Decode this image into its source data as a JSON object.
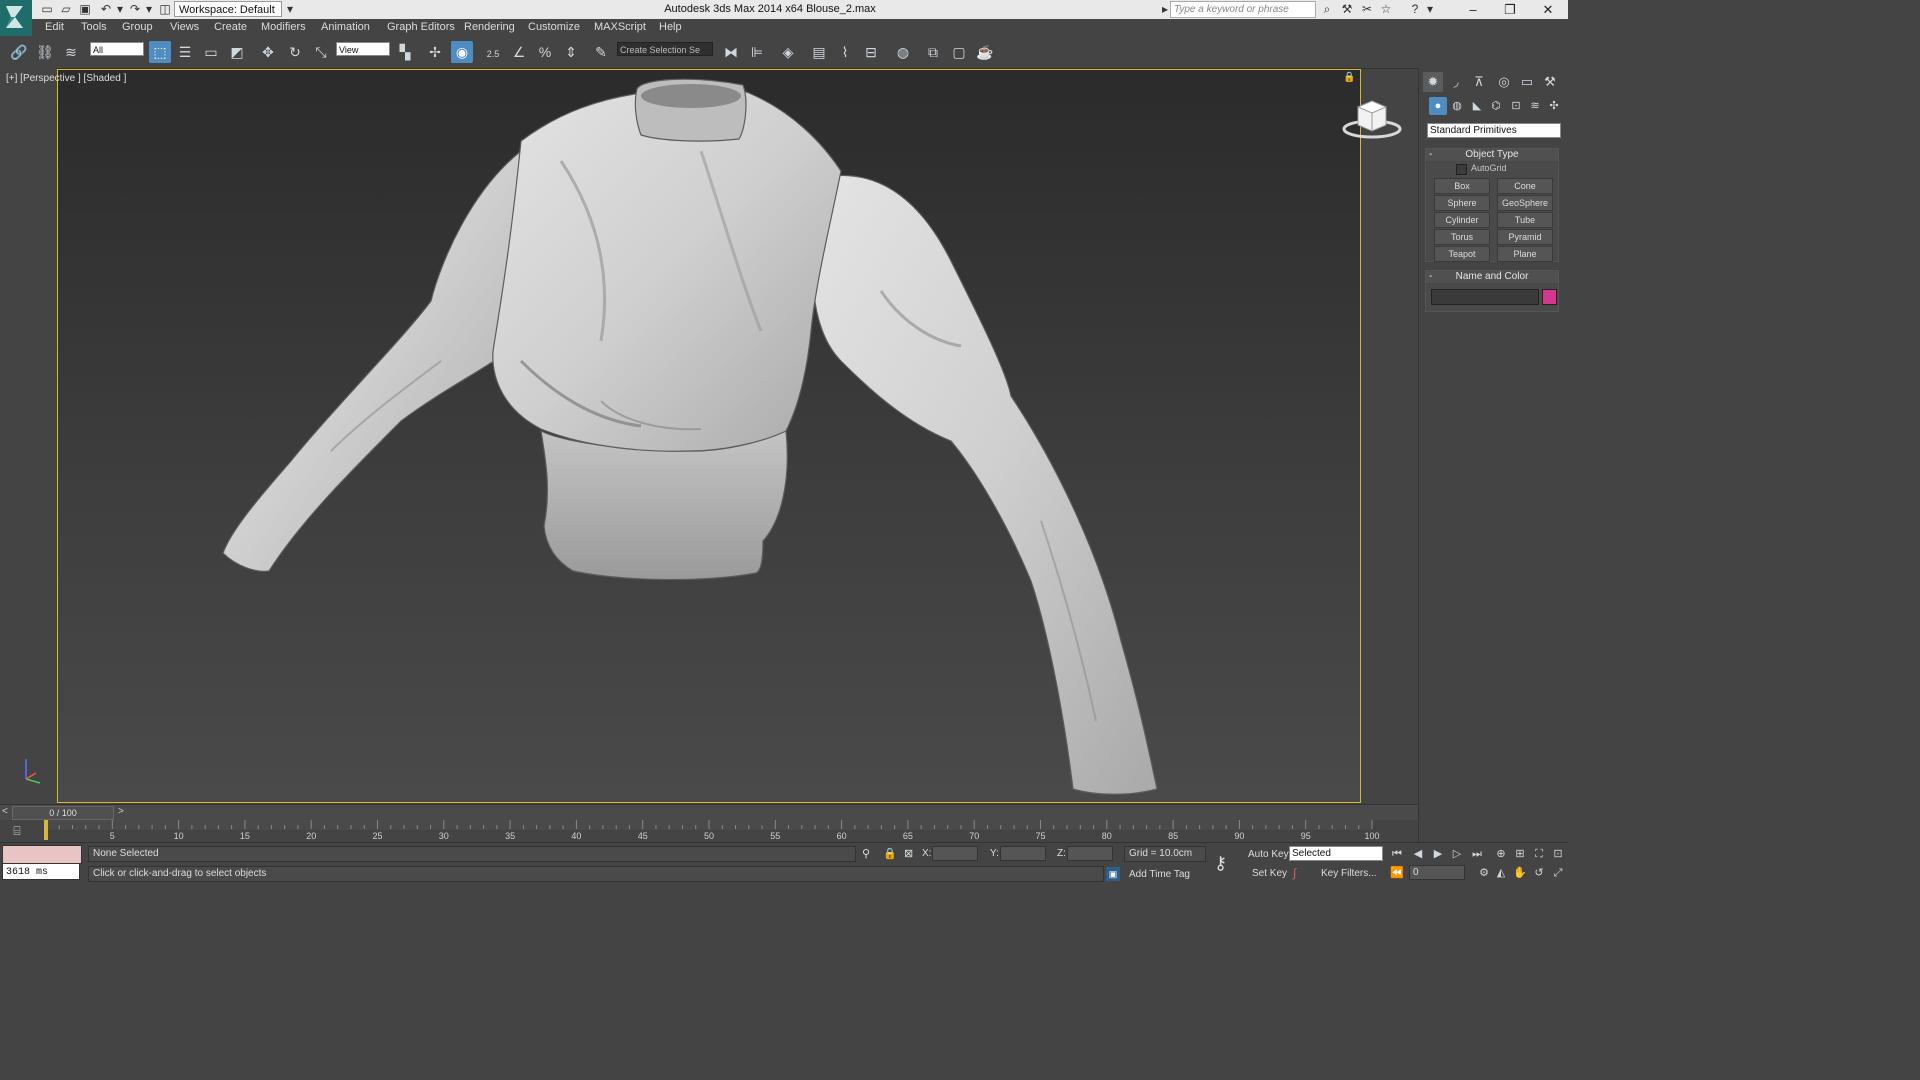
{
  "app": {
    "window_title": "Autodesk 3ds Max  2014 x64      Blouse_2.max",
    "workspace": "Workspace: Default",
    "search_placeholder": "Type a keyword or phrase"
  },
  "menu": [
    "Edit",
    "Tools",
    "Group",
    "Views",
    "Create",
    "Modifiers",
    "Animation",
    "Graph Editors",
    "Rendering",
    "Customize",
    "MAXScript",
    "Help"
  ],
  "toolbar": {
    "selection_filter": "All",
    "ref_coord": "View",
    "snap_value": "2.5",
    "named_selection": "Create Selection Se"
  },
  "viewport": {
    "label": "[+] [Perspective ] [Shaded ]"
  },
  "command_panel": {
    "category": "Standard Primitives",
    "object_type_title": "Object Type",
    "autogrid_label": "AutoGrid",
    "primitives": [
      "Box",
      "Cone",
      "Sphere",
      "GeoSphere",
      "Cylinder",
      "Tube",
      "Torus",
      "Pyramid",
      "Teapot",
      "Plane"
    ],
    "name_color_title": "Name and Color",
    "object_color": "#d4388e"
  },
  "timeline": {
    "frame_readout": "0 / 100",
    "ticks": [
      "5",
      "10",
      "15",
      "20",
      "25",
      "30",
      "35",
      "40",
      "45",
      "50",
      "55",
      "60",
      "65",
      "70",
      "75",
      "80",
      "85",
      "90",
      "95",
      "100"
    ]
  },
  "status": {
    "script_timing": "3618 ms",
    "selection": "None Selected",
    "prompt": "Click or click-and-drag to select objects",
    "x_label": "X:",
    "y_label": "Y:",
    "z_label": "Z:",
    "grid": "Grid = 10.0cm",
    "add_time_tag": "Add Time Tag",
    "auto_key": "Auto Key",
    "set_key": "Set Key",
    "key_mode": "Selected",
    "key_filters": "Key Filters...",
    "current_frame": "0"
  },
  "colors": {
    "viewport_border": "#d7b735",
    "active_button": "#4e8cc2",
    "logo_bg": "#1f6d6a"
  }
}
